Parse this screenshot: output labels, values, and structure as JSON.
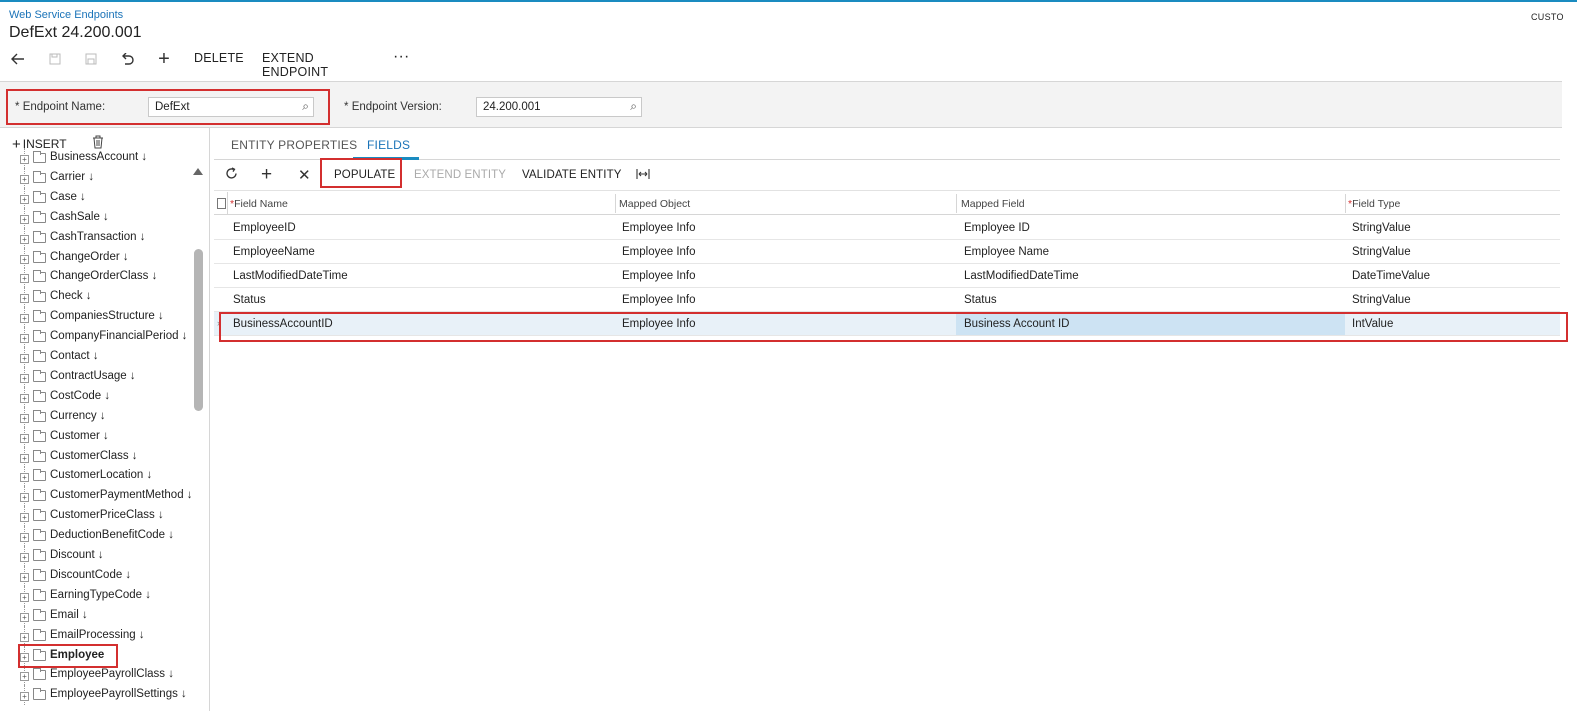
{
  "header": {
    "breadcrumb": "Web Service Endpoints",
    "title": "DefExt 24.200.001",
    "top_right": "CUSTO"
  },
  "toolbar": {
    "delete_label": "DELETE",
    "extend_endpoint_label": "EXTEND ENDPOINT",
    "more_label": "···"
  },
  "form": {
    "endpoint_name_label": "Endpoint Name:",
    "endpoint_name_value": "DefExt",
    "endpoint_version_label": "Endpoint Version:",
    "endpoint_version_value": "24.200.001",
    "required_mark": "*"
  },
  "tree": {
    "insert_label": "INSERT",
    "items": [
      {
        "label": "BusinessAccount ↓"
      },
      {
        "label": "Carrier ↓"
      },
      {
        "label": "Case ↓"
      },
      {
        "label": "CashSale ↓"
      },
      {
        "label": "CashTransaction ↓"
      },
      {
        "label": "ChangeOrder ↓"
      },
      {
        "label": "ChangeOrderClass ↓"
      },
      {
        "label": "Check ↓"
      },
      {
        "label": "CompaniesStructure ↓"
      },
      {
        "label": "CompanyFinancialPeriod ↓"
      },
      {
        "label": "Contact ↓"
      },
      {
        "label": "ContractUsage ↓"
      },
      {
        "label": "CostCode ↓"
      },
      {
        "label": "Currency ↓"
      },
      {
        "label": "Customer ↓"
      },
      {
        "label": "CustomerClass ↓"
      },
      {
        "label": "CustomerLocation ↓"
      },
      {
        "label": "CustomerPaymentMethod ↓"
      },
      {
        "label": "CustomerPriceClass ↓"
      },
      {
        "label": "DeductionBenefitCode ↓"
      },
      {
        "label": "Discount ↓"
      },
      {
        "label": "DiscountCode ↓"
      },
      {
        "label": "EarningTypeCode ↓"
      },
      {
        "label": "Email ↓"
      },
      {
        "label": "EmailProcessing ↓"
      },
      {
        "label": "Employee"
      },
      {
        "label": "EmployeePayrollClass ↓"
      },
      {
        "label": "EmployeePayrollSettings ↓"
      }
    ]
  },
  "tabs": {
    "entity_properties": "ENTITY PROPERTIES",
    "fields": "FIELDS"
  },
  "grid_toolbar": {
    "populate": "POPULATE",
    "extend_entity": "EXTEND ENTITY",
    "validate_entity": "VALIDATE ENTITY"
  },
  "grid": {
    "columns": {
      "field_name": "Field Name",
      "mapped_object": "Mapped Object",
      "mapped_field": "Mapped Field",
      "field_type": "Field Type"
    },
    "rows": [
      {
        "field_name": "EmployeeID",
        "mapped_object": "Employee Info",
        "mapped_field": "Employee ID",
        "field_type": "StringValue"
      },
      {
        "field_name": "EmployeeName",
        "mapped_object": "Employee Info",
        "mapped_field": "Employee Name",
        "field_type": "StringValue"
      },
      {
        "field_name": "LastModifiedDateTime",
        "mapped_object": "Employee Info",
        "mapped_field": "LastModifiedDateTime",
        "field_type": "DateTimeValue"
      },
      {
        "field_name": "Status",
        "mapped_object": "Employee Info",
        "mapped_field": "Status",
        "field_type": "StringValue"
      },
      {
        "field_name": "BusinessAccountID",
        "mapped_object": "Employee Info",
        "mapped_field": "Business Account ID",
        "field_type": "IntValue"
      }
    ]
  },
  "colors": {
    "accent": "#1a8bc0",
    "link": "#1a73b8",
    "highlight_box": "#d32f2f",
    "selected_row": "#e8f1f8"
  }
}
